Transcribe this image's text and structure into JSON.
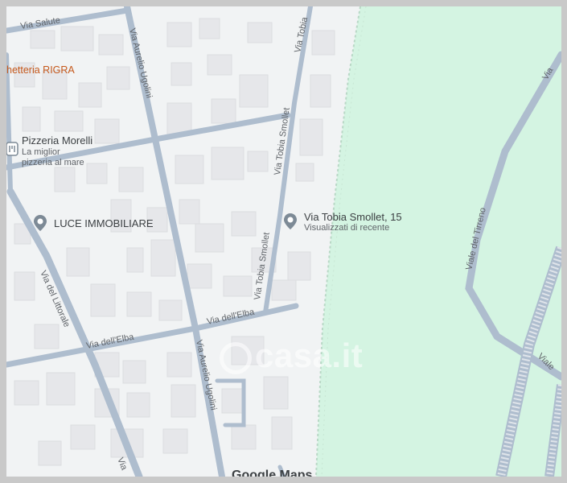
{
  "map": {
    "watermark": "casa.it",
    "attribution": "Google Maps",
    "colors": {
      "background": "#f1f3f4",
      "building": "#e6e7ea",
      "road": "#aebdce",
      "park": "#d4f4e2",
      "pin": "#7d8a96",
      "shop_label": "#c5581b"
    },
    "pois": [
      {
        "name": "Pizzeria Morelli",
        "sub": [
          "La miglior",
          "pizzeria al mare"
        ],
        "icon": "restaurant-icon"
      },
      {
        "name": "LUCE IMMOBILIARE",
        "icon": "place-pin-icon"
      },
      {
        "name": "Via Tobia Smollet, 15",
        "sub": [
          "Visualizzati di recente"
        ],
        "icon": "place-pin-icon"
      }
    ],
    "shop_label": "hetteria RIGRA",
    "streets": [
      "Via Salute",
      "Via Aurelio Ugolini",
      "Via Tobia",
      "Via Tobia Smollet",
      "Via Tobia Smollet",
      "Via dell'Elba",
      "Via dell'Elba",
      "Via del Littorale",
      "Via Aurelio Ugolini",
      "Viale del Tirreno",
      "Viale",
      "Via",
      "Via"
    ]
  }
}
